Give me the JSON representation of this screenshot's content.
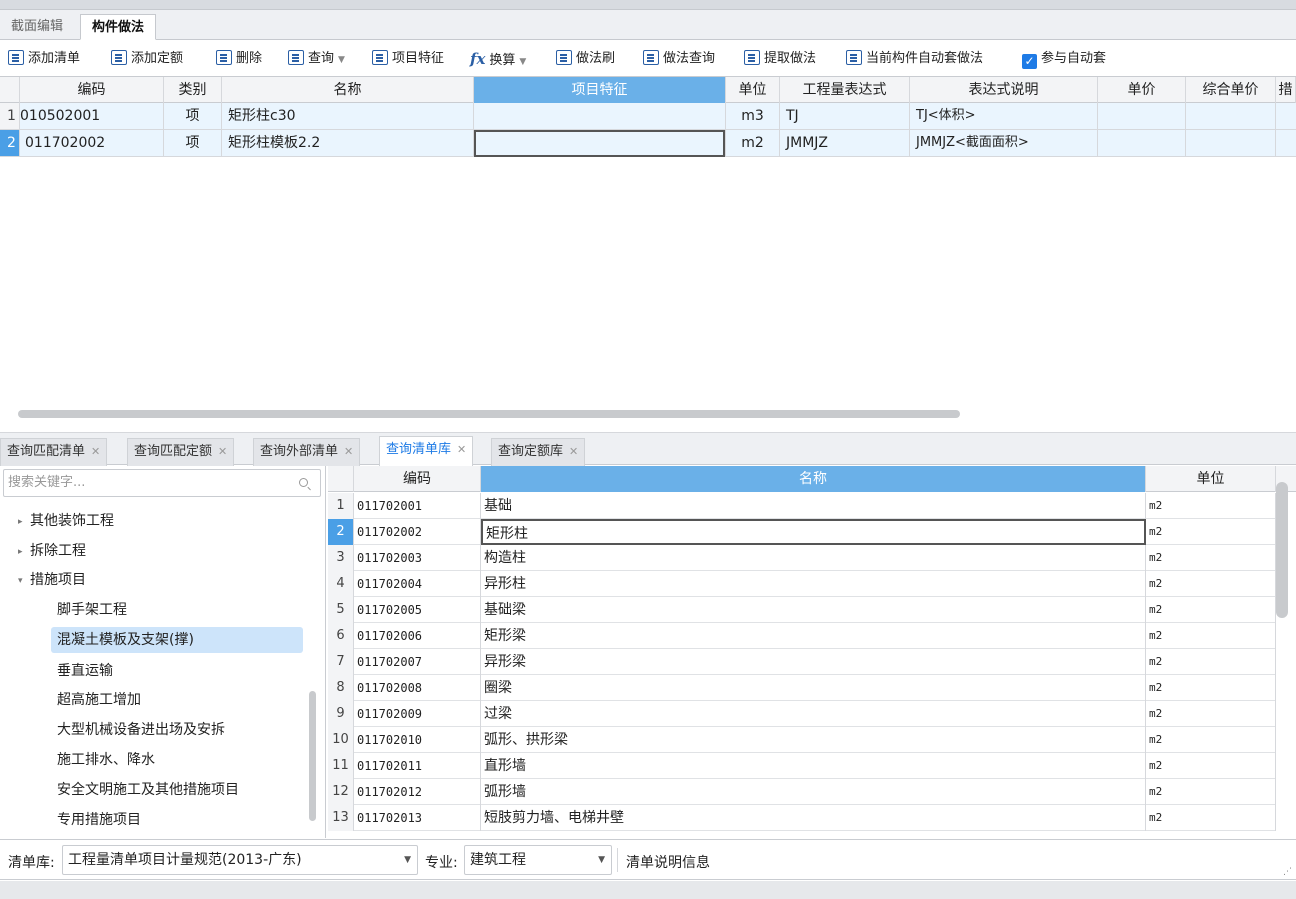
{
  "main_tabs": [
    "截面编辑",
    "构件做法"
  ],
  "toolbar": {
    "add_list": "添加清单",
    "add_quota": "添加定额",
    "delete": "删除",
    "query": "查询",
    "item_feature": "项目特征",
    "convert": "换算",
    "method_brush": "做法刷",
    "method_query": "做法查询",
    "extract_method": "提取做法",
    "auto_method": "当前构件自动套做法",
    "auto_apply": "参与自动套",
    "auto_apply_checked": true
  },
  "upper_grid": {
    "headers": [
      "编码",
      "类别",
      "名称",
      "项目特征",
      "单位",
      "工程量表达式",
      "表达式说明",
      "单价",
      "综合单价",
      "措"
    ],
    "selected_header": "项目特征",
    "current_row": 2,
    "rows": [
      {
        "num": "1",
        "code": "010502001",
        "type": "项",
        "name": "矩形柱c30",
        "feature": "",
        "unit": "m3",
        "expr": "TJ",
        "expr_desc": "TJ<体积>",
        "price": "",
        "total_price": ""
      },
      {
        "num": "2",
        "code": "011702002",
        "type": "项",
        "name": "矩形柱模板2.2",
        "feature": "",
        "unit": "m2",
        "expr": "JMMJZ",
        "expr_desc": "JMMJZ<截面面积>",
        "price": "",
        "total_price": ""
      }
    ]
  },
  "lower_tabs": [
    "查询匹配清单",
    "查询匹配定额",
    "查询外部清单",
    "查询清单库",
    "查询定额库"
  ],
  "active_lower_tab": "查询清单库",
  "tree": {
    "search_placeholder": "搜索关键字...",
    "nodes": [
      {
        "label": "其他装饰工程",
        "expander": "▸"
      },
      {
        "label": "拆除工程",
        "expander": "▸"
      },
      {
        "label": "措施项目",
        "expander": "▾"
      },
      {
        "label": "脚手架工程",
        "expander": ""
      },
      {
        "label": "混凝土模板及支架(撑)",
        "expander": "",
        "selected": true
      },
      {
        "label": "垂直运输",
        "expander": ""
      },
      {
        "label": "超高施工增加",
        "expander": ""
      },
      {
        "label": "大型机械设备进出场及安拆",
        "expander": ""
      },
      {
        "label": "施工排水、降水",
        "expander": ""
      },
      {
        "label": "安全文明施工及其他措施项目",
        "expander": ""
      },
      {
        "label": "专用措施项目",
        "expander": ""
      }
    ]
  },
  "list_grid": {
    "headers": [
      "编码",
      "名称",
      "单位"
    ],
    "selected_header": "名称",
    "current_row": 2,
    "rows": [
      {
        "num": "1",
        "code": "011702001",
        "name": "基础",
        "unit": "m2"
      },
      {
        "num": "2",
        "code": "011702002",
        "name": "矩形柱",
        "unit": "m2"
      },
      {
        "num": "3",
        "code": "011702003",
        "name": "构造柱",
        "unit": "m2"
      },
      {
        "num": "4",
        "code": "011702004",
        "name": "异形柱",
        "unit": "m2"
      },
      {
        "num": "5",
        "code": "011702005",
        "name": "基础梁",
        "unit": "m2"
      },
      {
        "num": "6",
        "code": "011702006",
        "name": "矩形梁",
        "unit": "m2"
      },
      {
        "num": "7",
        "code": "011702007",
        "name": "异形梁",
        "unit": "m2"
      },
      {
        "num": "8",
        "code": "011702008",
        "name": "圈梁",
        "unit": "m2"
      },
      {
        "num": "9",
        "code": "011702009",
        "name": "过梁",
        "unit": "m2"
      },
      {
        "num": "10",
        "code": "011702010",
        "name": "弧形、拱形梁",
        "unit": "m2"
      },
      {
        "num": "11",
        "code": "011702011",
        "name": "直形墙",
        "unit": "m2"
      },
      {
        "num": "12",
        "code": "011702012",
        "name": "弧形墙",
        "unit": "m2"
      },
      {
        "num": "13",
        "code": "011702013",
        "name": "短肢剪力墙、电梯井壁",
        "unit": "m2"
      }
    ]
  },
  "bottom_bar": {
    "library_label": "清单库:",
    "library_value": "工程量清单项目计量规范(2013-广东)",
    "major_label": "专业:",
    "major_value": "建筑工程",
    "info_label": "清单说明信息"
  },
  "colors": {
    "header_selected": "#6ab0e8",
    "row_current": "#4a9fe6",
    "row_background": "#eaf5fe",
    "tree_selected": "#cde4fa",
    "active_tab_text": "#1e7be6"
  }
}
